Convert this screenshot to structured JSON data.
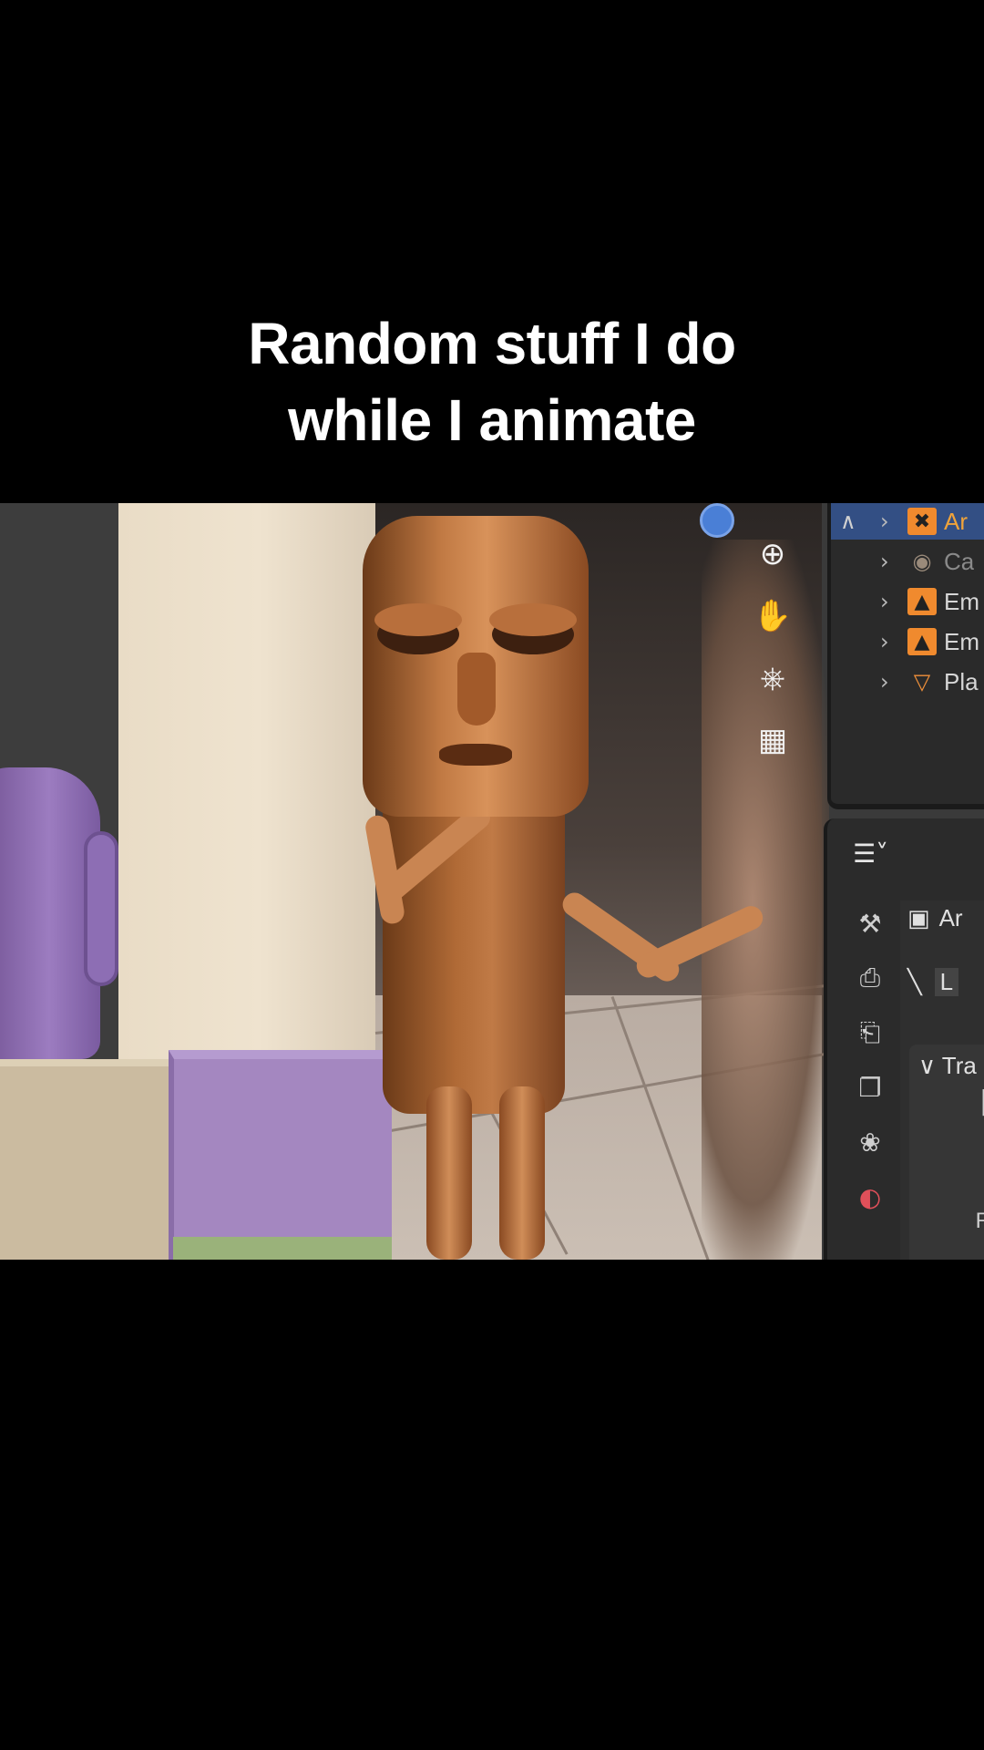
{
  "caption": {
    "line1": "Random stuff I do",
    "line2": "while I animate"
  },
  "viewport_tools": [
    {
      "icon": "zoom-icon",
      "glyph": "⊕"
    },
    {
      "icon": "hand-pan-icon",
      "glyph": "✋"
    },
    {
      "icon": "camera-view-icon",
      "glyph": "⎈"
    },
    {
      "icon": "grid-view-icon",
      "glyph": "▦"
    }
  ],
  "outliner": {
    "rows": [
      {
        "label": "Ar",
        "icon": "armature-icon",
        "selected": true
      },
      {
        "label": "Ca",
        "icon": "camera-icon",
        "dimmed": true
      },
      {
        "label": "Em",
        "icon": "image-empty-icon"
      },
      {
        "label": "Em",
        "icon": "image-empty-icon"
      },
      {
        "label": "Pla",
        "icon": "mesh-plane-icon"
      }
    ]
  },
  "properties": {
    "editor_type_glyph": "☰˅",
    "object_label": "Ar",
    "bone_label": "L",
    "transform_header": "Tra",
    "field_label": "R",
    "tabs": [
      {
        "icon": "tool-icon",
        "glyph": "⚒"
      },
      {
        "icon": "render-icon",
        "glyph": "⎙"
      },
      {
        "icon": "output-icon",
        "glyph": "⎗"
      },
      {
        "icon": "view-layer-icon",
        "glyph": "❐"
      },
      {
        "icon": "scene-icon",
        "glyph": "❀"
      },
      {
        "icon": "world-icon",
        "glyph": "◐",
        "color": "#e0505a"
      }
    ]
  },
  "colors": {
    "selection_blue": "#334f84",
    "armature_orange": "#f0a33a"
  }
}
